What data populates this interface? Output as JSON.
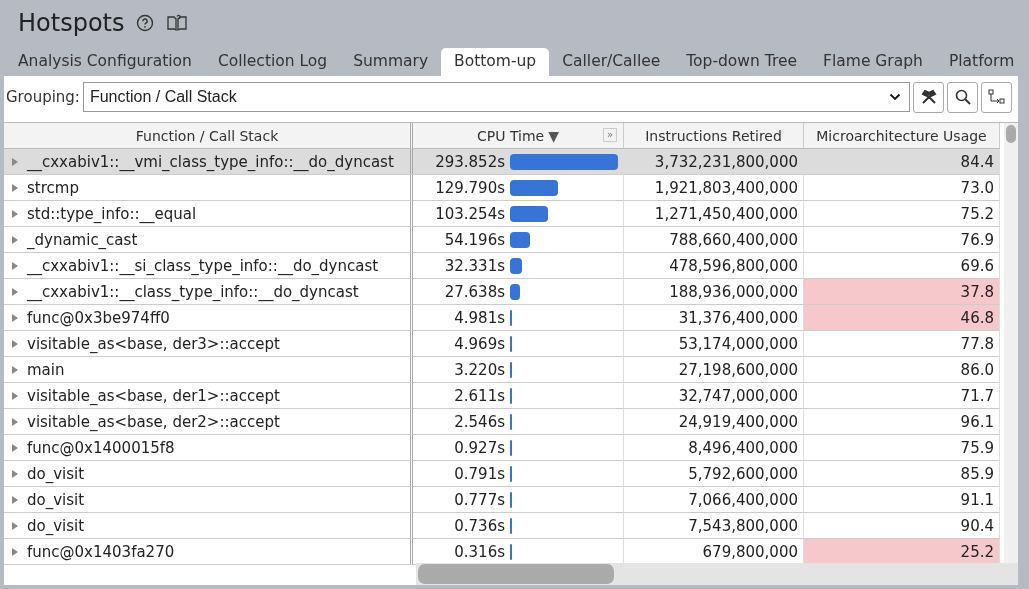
{
  "window": {
    "title": "Hotspots"
  },
  "tabs": [
    {
      "label": "Analysis Configuration",
      "selected": false
    },
    {
      "label": "Collection Log",
      "selected": false
    },
    {
      "label": "Summary",
      "selected": false
    },
    {
      "label": "Bottom-up",
      "selected": true
    },
    {
      "label": "Caller/Callee",
      "selected": false
    },
    {
      "label": "Top-down Tree",
      "selected": false
    },
    {
      "label": "Flame Graph",
      "selected": false
    },
    {
      "label": "Platform",
      "selected": false
    }
  ],
  "grouping": {
    "label": "Grouping:",
    "value": "Function / Call Stack"
  },
  "table": {
    "columns": [
      {
        "label": "Function / Call Stack"
      },
      {
        "label": "CPU Time",
        "sort": "▼",
        "expand": "»"
      },
      {
        "label": "Instructions Retired"
      },
      {
        "label": "Microarchitecture Usage"
      }
    ],
    "rows": [
      {
        "function": "__cxxabiv1::__vmi_class_type_info::__do_dyncast",
        "cpu_time": "293.852s",
        "instructions": "3,732,231,800,000",
        "usage": "84.4",
        "flagged": false,
        "selected": true
      },
      {
        "function": "strcmp",
        "cpu_time": "129.790s",
        "instructions": "1,921,803,400,000",
        "usage": "73.0",
        "flagged": false,
        "selected": false
      },
      {
        "function": "std::type_info::__equal",
        "cpu_time": "103.254s",
        "instructions": "1,271,450,400,000",
        "usage": "75.2",
        "flagged": false,
        "selected": false
      },
      {
        "function": "_dynamic_cast",
        "cpu_time": "54.196s",
        "instructions": "788,660,400,000",
        "usage": "76.9",
        "flagged": false,
        "selected": false
      },
      {
        "function": "__cxxabiv1::__si_class_type_info::__do_dyncast",
        "cpu_time": "32.331s",
        "instructions": "478,596,800,000",
        "usage": "69.6",
        "flagged": false,
        "selected": false
      },
      {
        "function": "__cxxabiv1::__class_type_info::__do_dyncast",
        "cpu_time": "27.638s",
        "instructions": "188,936,000,000",
        "usage": "37.8",
        "flagged": true,
        "selected": false
      },
      {
        "function": "func@0x3be974ff0",
        "cpu_time": "4.981s",
        "instructions": "31,376,400,000",
        "usage": "46.8",
        "flagged": true,
        "selected": false
      },
      {
        "function": "visitable_as<base, der3>::accept",
        "cpu_time": "4.969s",
        "instructions": "53,174,000,000",
        "usage": "77.8",
        "flagged": false,
        "selected": false
      },
      {
        "function": "main",
        "cpu_time": "3.220s",
        "instructions": "27,198,600,000",
        "usage": "86.0",
        "flagged": false,
        "selected": false
      },
      {
        "function": "visitable_as<base, der1>::accept",
        "cpu_time": "2.611s",
        "instructions": "32,747,000,000",
        "usage": "71.7",
        "flagged": false,
        "selected": false
      },
      {
        "function": "visitable_as<base, der2>::accept",
        "cpu_time": "2.546s",
        "instructions": "24,919,400,000",
        "usage": "96.1",
        "flagged": false,
        "selected": false
      },
      {
        "function": "func@0x1400015f8",
        "cpu_time": "0.927s",
        "instructions": "8,496,400,000",
        "usage": "75.9",
        "flagged": false,
        "selected": false
      },
      {
        "function": "do_visit",
        "cpu_time": "0.791s",
        "instructions": "5,792,600,000",
        "usage": "85.9",
        "flagged": false,
        "selected": false
      },
      {
        "function": "do_visit",
        "cpu_time": "0.777s",
        "instructions": "7,066,400,000",
        "usage": "91.1",
        "flagged": false,
        "selected": false
      },
      {
        "function": "do_visit",
        "cpu_time": "0.736s",
        "instructions": "7,543,800,000",
        "usage": "90.4",
        "flagged": false,
        "selected": false
      },
      {
        "function": "func@0x1403fa270",
        "cpu_time": "0.316s",
        "instructions": "679,800,000",
        "usage": "25.2",
        "flagged": true,
        "selected": false
      }
    ]
  }
}
